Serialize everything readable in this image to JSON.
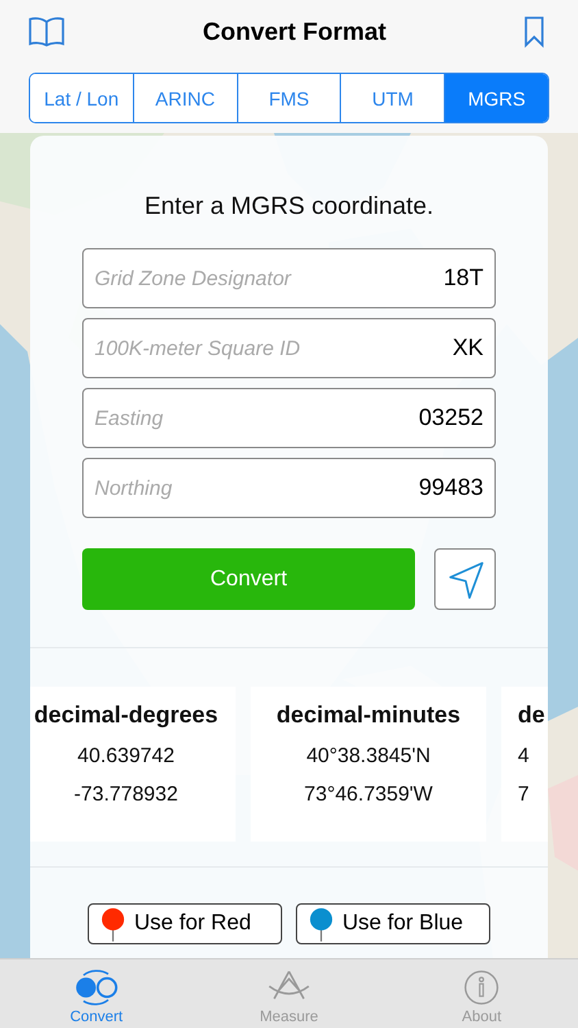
{
  "header": {
    "title": "Convert Format"
  },
  "format_tabs": [
    {
      "label": "Lat / Lon",
      "selected": false
    },
    {
      "label": "ARINC",
      "selected": false
    },
    {
      "label": "FMS",
      "selected": false
    },
    {
      "label": "UTM",
      "selected": false
    },
    {
      "label": "MGRS",
      "selected": true
    }
  ],
  "form": {
    "prompt": "Enter a MGRS coordinate.",
    "fields": [
      {
        "placeholder": "Grid Zone Designator",
        "value": "18T"
      },
      {
        "placeholder": "100K-meter Square ID",
        "value": "XK"
      },
      {
        "placeholder": "Easting",
        "value": "03252"
      },
      {
        "placeholder": "Northing",
        "value": "99483"
      }
    ],
    "convert_button": "Convert"
  },
  "results": [
    {
      "heading": "decimal-degrees",
      "lines": [
        "40.639742",
        "-73.778932"
      ]
    },
    {
      "heading": "decimal-minutes",
      "lines": [
        "40°38.3845'N",
        "73°46.7359'W"
      ]
    },
    {
      "heading": "de",
      "lines": [
        "4",
        "7"
      ]
    }
  ],
  "pin_buttons": [
    {
      "label": "Use for Red",
      "color": "#ff2a00"
    },
    {
      "label": "Use for Blue",
      "color": "#0a8fcf"
    }
  ],
  "tab_bar": [
    {
      "label": "Convert",
      "kind": "convert",
      "selected": true
    },
    {
      "label": "Measure",
      "kind": "measure",
      "selected": false
    },
    {
      "label": "About",
      "kind": "about",
      "selected": false
    }
  ]
}
